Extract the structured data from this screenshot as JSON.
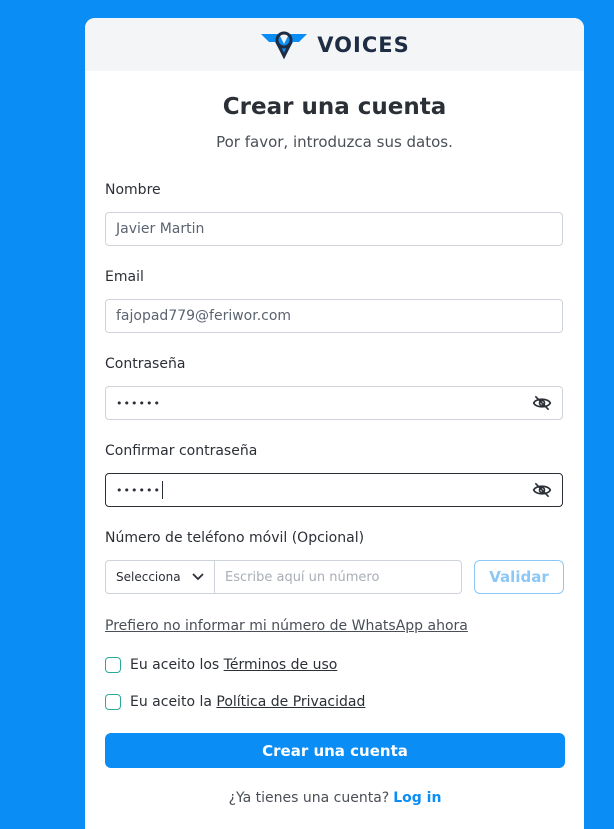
{
  "brand": {
    "name": "VOICES"
  },
  "header": {
    "title": "Crear una cuenta",
    "subtitle": "Por favor, introduzca sus datos."
  },
  "form": {
    "name": {
      "label": "Nombre",
      "value": "Javier Martin"
    },
    "email": {
      "label": "Email",
      "value": "fajopad779@feriwor.com"
    },
    "password": {
      "label": "Contraseña",
      "value": "••••••"
    },
    "confirm_password": {
      "label": "Confirmar contraseña",
      "value": "••••••"
    },
    "phone": {
      "label": "Número de teléfono móvil (Opcional)",
      "country_placeholder": "Selecciona",
      "number_placeholder": "Escribe aquí un número",
      "validate_label": "Validar"
    },
    "skip_whatsapp_link": "Prefiero no informar mi número de WhatsApp ahora",
    "terms": {
      "prefix": "Eu aceito los",
      "link": "Términos de uso"
    },
    "privacy": {
      "prefix": "Eu aceito la",
      "link": "Política de Privacidad"
    },
    "submit_label": "Crear una cuenta"
  },
  "footer": {
    "question": "¿Ya tienes una cuenta?",
    "login_label": "Log in"
  },
  "colors": {
    "primary": "#0a8df5",
    "checkbox": "#2aa99a",
    "text": "#2b2f36"
  }
}
